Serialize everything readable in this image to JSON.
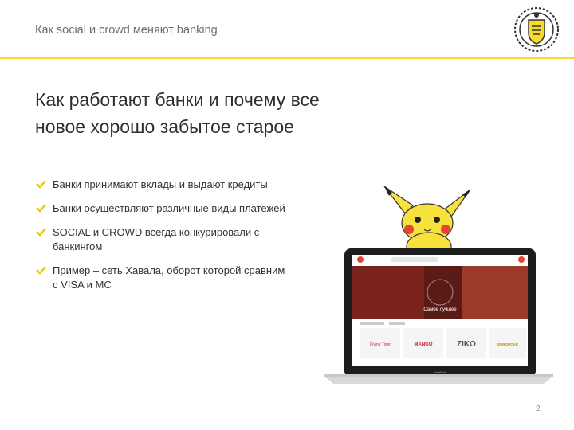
{
  "header": {
    "title": "Как social и crowd меняют banking",
    "logo_icon": "bank-emblem-icon",
    "accent_color": "#f5dc2a"
  },
  "slide": {
    "title_line1": "Как работают банки и почему все",
    "title_line2": "новое хорошо забытое старое"
  },
  "bullets": [
    {
      "icon": "check-icon",
      "line1": "Банки принимают вклады и выдают кредиты",
      "line2": ""
    },
    {
      "icon": "check-icon",
      "line1": "Банки осуществляют различные виды платежей",
      "line2": ""
    },
    {
      "icon": "check-icon",
      "line1": "SOCIAL и CROWD всегда конкурировали с",
      "line2": "банкингом"
    },
    {
      "icon": "check-icon",
      "line1": "Пример – сеть Хавала, оборот которой сравним",
      "line2": "с VISA и МС"
    }
  ],
  "laptop_screen": {
    "hero_text": "Самое лучшее",
    "logos": [
      "Flying Tiger",
      "MANGO",
      "ZIKO",
      "EUROPCAR"
    ],
    "brand_label": "MacBook"
  },
  "page_number": "2"
}
